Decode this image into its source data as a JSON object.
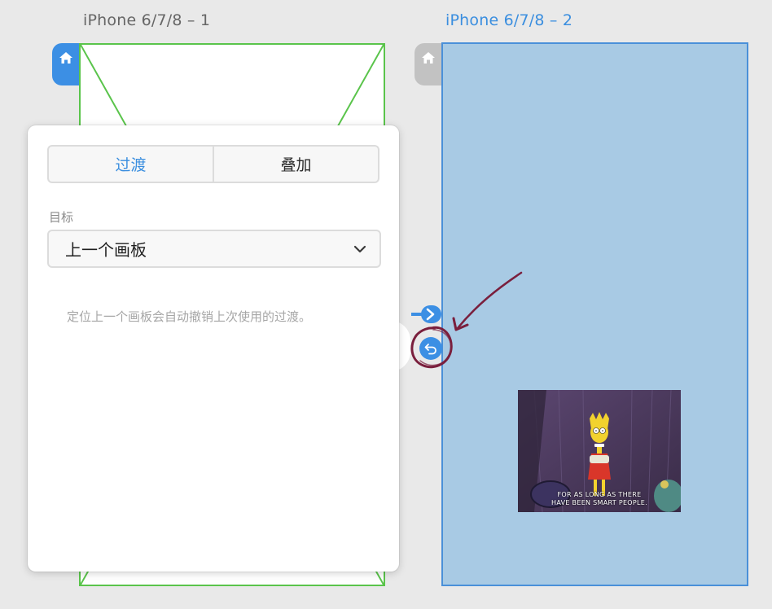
{
  "artboards": [
    {
      "title": "iPhone 6/7/8 – 1"
    },
    {
      "title": "iPhone 6/7/8 – 2"
    }
  ],
  "colors": {
    "accent": "#3a8edf",
    "artboard1_border": "#5ac44b",
    "artboard2_fill": "#a8cae4",
    "annotation": "#7a1f3d"
  },
  "popover": {
    "tabs": [
      {
        "label": "过渡",
        "active": true
      },
      {
        "label": "叠加",
        "active": false
      }
    ],
    "target_label": "目标",
    "target_value": "上一个画板",
    "hint": "定位上一个画板会自动撤销上次使用的过渡。"
  },
  "thumbnail": {
    "caption_line1": "FOR AS LONG AS THERE",
    "caption_line2": "HAVE BEEN SMART PEOPLE."
  },
  "icons": {
    "home": "home-icon",
    "chevron": "chevron-down-icon",
    "back": "back-arrow-icon",
    "link": "chevron-right-icon"
  }
}
